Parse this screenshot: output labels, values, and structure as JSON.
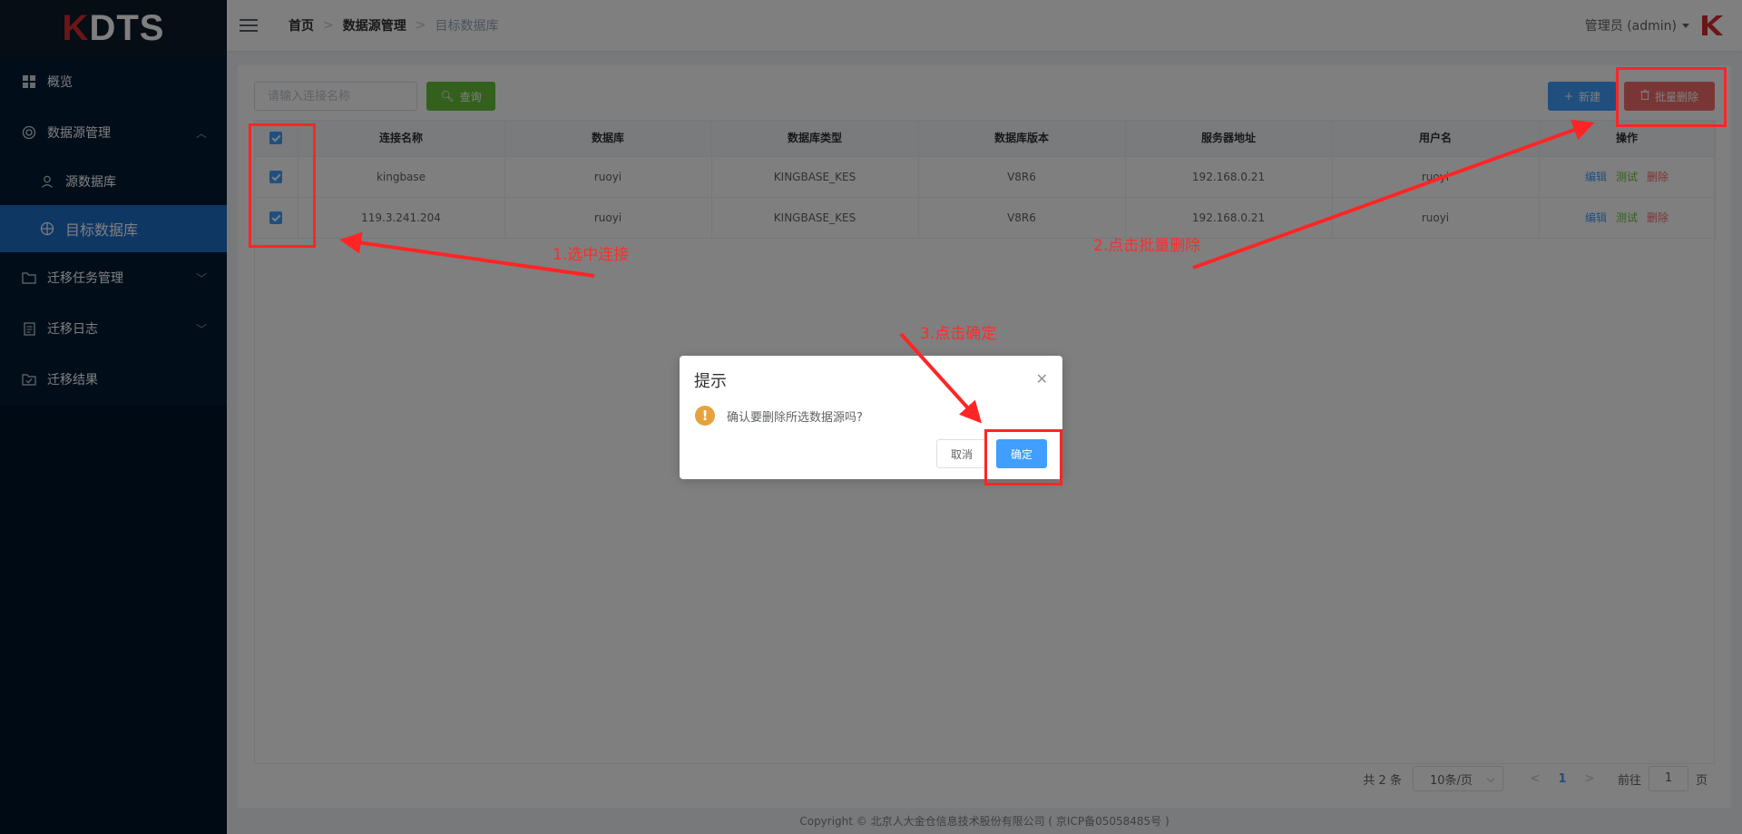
{
  "brand": {
    "logo_k": "K",
    "logo_rest": "DTS"
  },
  "sidebar": {
    "items": [
      {
        "label": "概览",
        "icon": "dashboard-icon"
      },
      {
        "label": "数据源管理",
        "icon": "database-icon"
      },
      {
        "label": "源数据库",
        "icon": "user-icon"
      },
      {
        "label": "目标数据库",
        "icon": "target-icon"
      },
      {
        "label": "迁移任务管理",
        "icon": "folder-icon"
      },
      {
        "label": "迁移日志",
        "icon": "document-icon"
      },
      {
        "label": "迁移结果",
        "icon": "folder-check-icon"
      }
    ]
  },
  "header": {
    "breadcrumb": [
      "首页",
      "数据源管理",
      "目标数据库"
    ],
    "user": "管理员 (admin)"
  },
  "toolbar": {
    "search_placeholder": "请输入连接名称",
    "query_label": "查询",
    "new_label": "新建",
    "batch_delete_label": "批量删除"
  },
  "table": {
    "columns": [
      "连接名称",
      "数据库",
      "数据库类型",
      "数据库版本",
      "服务器地址",
      "用户名",
      "操作"
    ],
    "rows": [
      {
        "name": "kingbase",
        "db": "ruoyi",
        "type": "KINGBASE_KES",
        "version": "V8R6",
        "host": "192.168.0.21",
        "user": "ruoyi"
      },
      {
        "name": "119.3.241.204",
        "db": "ruoyi",
        "type": "KINGBASE_KES",
        "version": "V8R6",
        "host": "192.168.0.21",
        "user": "ruoyi"
      }
    ],
    "actions": {
      "edit": "编辑",
      "test": "测试",
      "delete": "删除"
    }
  },
  "pagination": {
    "total": "共 2 条",
    "page_size": "10条/页",
    "current_page": "1",
    "goto_prefix": "前往",
    "goto_value": "1",
    "goto_suffix": "页"
  },
  "footer": "Copyright © 北京人大金仓信息技术股份有限公司 ( 京ICP备05058485号 )",
  "dialog": {
    "title": "提示",
    "message": "确认要删除所选数据源吗?",
    "cancel_label": "取消",
    "confirm_label": "确定"
  },
  "annotations": {
    "step1": "1.选中连接",
    "step2": "2.点击批量删除",
    "step3": "3.点击确定",
    "color": "#ff2525"
  }
}
